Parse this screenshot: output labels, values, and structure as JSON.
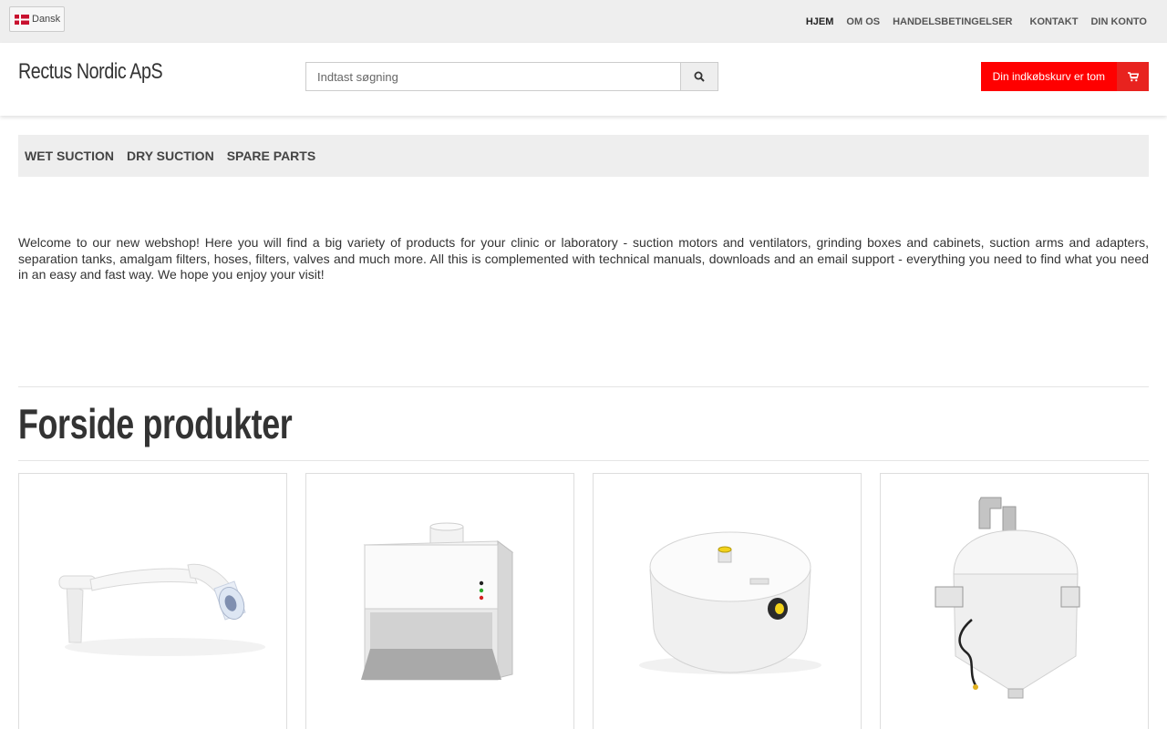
{
  "topbar": {
    "language": "Dansk",
    "nav": [
      {
        "label": "HJEM",
        "active": true
      },
      {
        "label": "OM OS",
        "active": false
      },
      {
        "label": "HANDELSBETINGELSER",
        "active": false
      },
      {
        "label": "KONTAKT",
        "active": false
      },
      {
        "label": "DIN KONTO",
        "active": false
      }
    ]
  },
  "header": {
    "logo": "Rectus Nordic ApS",
    "search_placeholder": "Indtast søgning",
    "cart_label": "Din indkøbskurv er tom"
  },
  "categories": [
    "WET SUCTION",
    "DRY SUCTION",
    "SPARE PARTS"
  ],
  "welcome_text": "Welcome to our new webshop! Here you will find a big variety of products for your clinic or laboratory - suction motors and ventilators, grinding boxes and cabinets, suction arms and adapters, separation tanks, amalgam filters, hoses, filters, valves and much more. All this is complemented with technical manuals, downloads and an email support - everything you need to find what you need in an easy and fast way. We hope you enjoy your visit!",
  "section_title": "Forside produkter",
  "colors": {
    "accent": "#ff0000",
    "topbar_bg": "#eeeeee"
  },
  "products": [
    {
      "image": "suction-arm"
    },
    {
      "image": "grinding-cabinet"
    },
    {
      "image": "separation-tank"
    },
    {
      "image": "cyclone-separator"
    }
  ]
}
